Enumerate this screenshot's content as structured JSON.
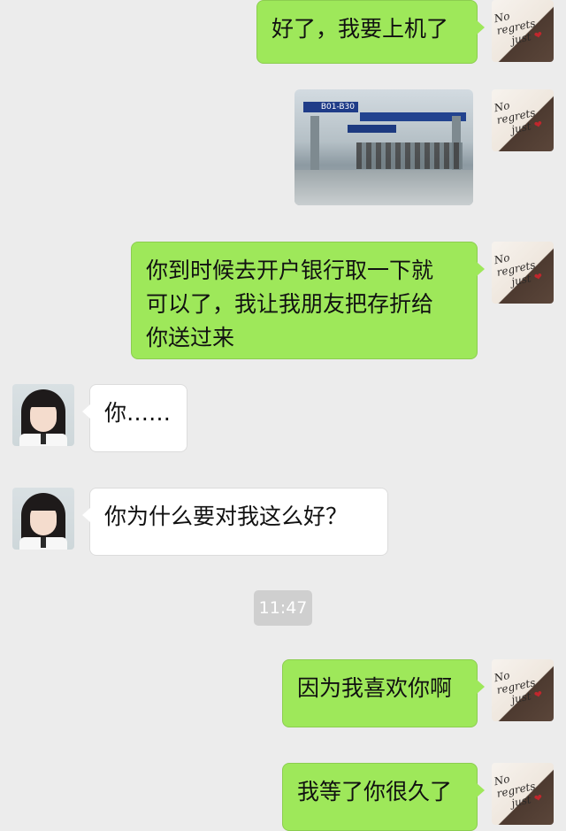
{
  "messages": [
    {
      "id": "m1",
      "side": "out",
      "text": "好了，我要上机了"
    },
    {
      "id": "m2",
      "side": "out",
      "type": "image"
    },
    {
      "id": "m3",
      "side": "out",
      "lines": [
        "你到时候去开户银行取一下就",
        "可以了，我让我朋友把存折给",
        "你送过来"
      ]
    },
    {
      "id": "m4",
      "side": "in",
      "text": "你……"
    },
    {
      "id": "m5",
      "side": "in",
      "text": "你为什么要对我这么好？"
    },
    {
      "id": "m6",
      "side": "out",
      "text": "因为我喜欢你啊"
    },
    {
      "id": "m7",
      "side": "out",
      "text": "我等了你很久了"
    }
  ],
  "timestamp": "11:47",
  "photo": {
    "sign_text": "B01-B30"
  },
  "my_avatar": {
    "line1": "No regrets",
    "line2": "just",
    "heart": "❤"
  },
  "colors": {
    "outgoing_bubble": "#9ee85a",
    "incoming_bubble": "#ffffff",
    "background": "#ececec"
  }
}
